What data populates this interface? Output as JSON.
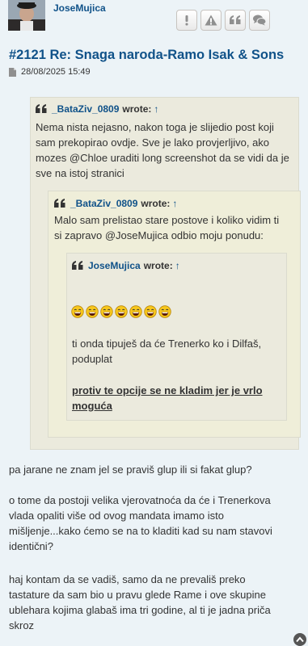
{
  "post": {
    "author": "JoseMujica",
    "title": "#2121 Re: Snaga naroda-Ramo Isak & Sons",
    "datetime": "28/08/2025 15:49"
  },
  "actions": [
    {
      "name": "report-button",
      "icon": "exclamation-icon"
    },
    {
      "name": "warn-button",
      "icon": "warning-triangle-icon"
    },
    {
      "name": "quote-button",
      "icon": "quote-icon"
    },
    {
      "name": "reply-button",
      "icon": "speech-bubbles-icon"
    }
  ],
  "quotes": {
    "outer": {
      "author": "_BataZiv_0809",
      "wrote": "wrote:",
      "lines": [
        "Nema nista nejasno, nakon toga je slijedio post koji",
        "sam prekopirao ovdje. Sve je lako provjerljivo, ako",
        "mozes @Chloe uraditi long screenshot da se vidi da je",
        "sve na istoj stranici"
      ]
    },
    "middle": {
      "author": "_BataZiv_0809",
      "wrote": "wrote:",
      "lines": [
        "Malo sam prelistao stare postove i koliko vidim ti",
        "si zapravo @JoseMujica odbio moju ponudu:"
      ]
    },
    "inner": {
      "author": "JoseMujica",
      "wrote": "wrote:",
      "smiley_count": 7,
      "lines": [
        "ti onda tipuješ da će Trenerko ko i Dilfaš,",
        "poduplat"
      ],
      "strong_lines": [
        "protiv te opcije se ne kladim jer je vrlo",
        "moguća"
      ]
    }
  },
  "body": {
    "p1": [
      "pa jarane ne znam jel se praviš glup ili si fakat glup?"
    ],
    "p2": [
      "o tome da postoji velika vjerovatnoća da će i Trenerkova",
      "vlada opaliti više od ovog mandata imamo isto",
      "mišljenje...kako ćemo se na to kladiti kad su nam stavovi",
      "identični?"
    ],
    "p3": [
      "haj kontam da se vadiš, samo da ne prevališ preko",
      "tastature da sam bio u pravu glede Rame i ove skupine",
      "ublehara kojima glabaš ima tri godine, al ti je jadna priča",
      "skroz"
    ]
  },
  "colors": {
    "link": "#105289",
    "page_bg": "#ecf3f7",
    "quote_bg": "#ebeadd",
    "quote_bg_alt": "#efeed9"
  }
}
